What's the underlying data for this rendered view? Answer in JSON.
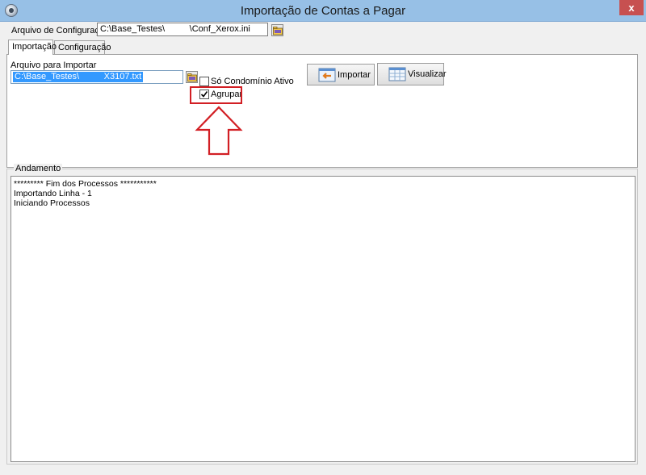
{
  "window": {
    "title": "Importação de Contas a Pagar",
    "close_label": "x"
  },
  "config": {
    "label": "Arquivo de Configuração",
    "value": "C:\\Base_Testes\\          \\Conf_Xerox.ini"
  },
  "tabs": [
    {
      "label": "Importação"
    },
    {
      "label": "Configuração"
    }
  ],
  "import_tab": {
    "file_label": "Arquivo para Importar",
    "file_value": "C:\\Base_Testes\\          X3107.txt",
    "checkbox_condominio": {
      "label": "Só Condomínio Ativo",
      "checked": false
    },
    "checkbox_agrupar": {
      "label": "Agrupar",
      "checked": true
    },
    "import_button": "Importar",
    "view_button": "Visualizar"
  },
  "progress": {
    "legend": "Andamento",
    "lines": [
      "********* Fim dos Processos ***********",
      "Importando Linha - 1",
      "Iniciando Processos"
    ]
  },
  "colors": {
    "titlebar": "#97c0e6",
    "close": "#c75050",
    "highlight": "#d21f24",
    "selection": "#3399ff"
  }
}
